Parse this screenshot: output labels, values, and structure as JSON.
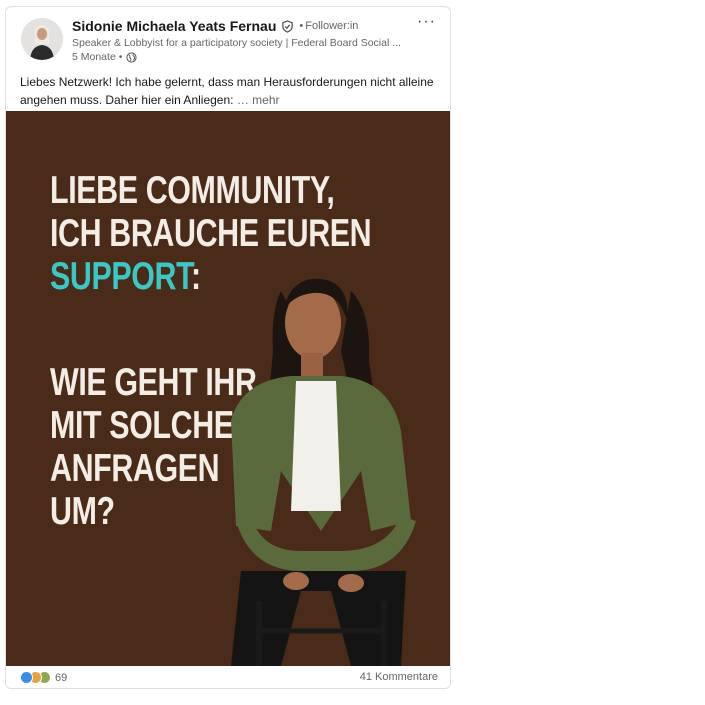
{
  "author": {
    "name": "Sidonie Michaela Yeats Fernau",
    "relation": "Follower:in",
    "headline": "Speaker & Lobbyist for a participatory society | Federal Board Social ...",
    "time": "5 Monate"
  },
  "post": {
    "text": "Liebes Netzwerk! Ich habe gelernt, dass man Herausforderungen nicht alleine angehen muss. Daher hier ein Anliegen:",
    "see_more": "… mehr"
  },
  "image": {
    "line1": "LIEBE COMMUNITY,",
    "line2": "ICH BRAUCHE EUREN",
    "line3_accent": "SUPPORT",
    "line3_suffix": ":",
    "line4": "WIE  GEHT IHR",
    "line5": "MIT SOLCHEN",
    "line6": "ANFRAGEN",
    "line7": "UM?",
    "background_color": "#4a2a18",
    "accent_color": "#3cc7c4"
  },
  "social": {
    "reaction_count": "69",
    "comments": "41 Kommentare"
  },
  "icons": [
    "verified-shield-icon",
    "globe-icon",
    "more-options-icon",
    "like-reaction-icon",
    "celebrate-reaction-icon",
    "support-reaction-icon"
  ]
}
